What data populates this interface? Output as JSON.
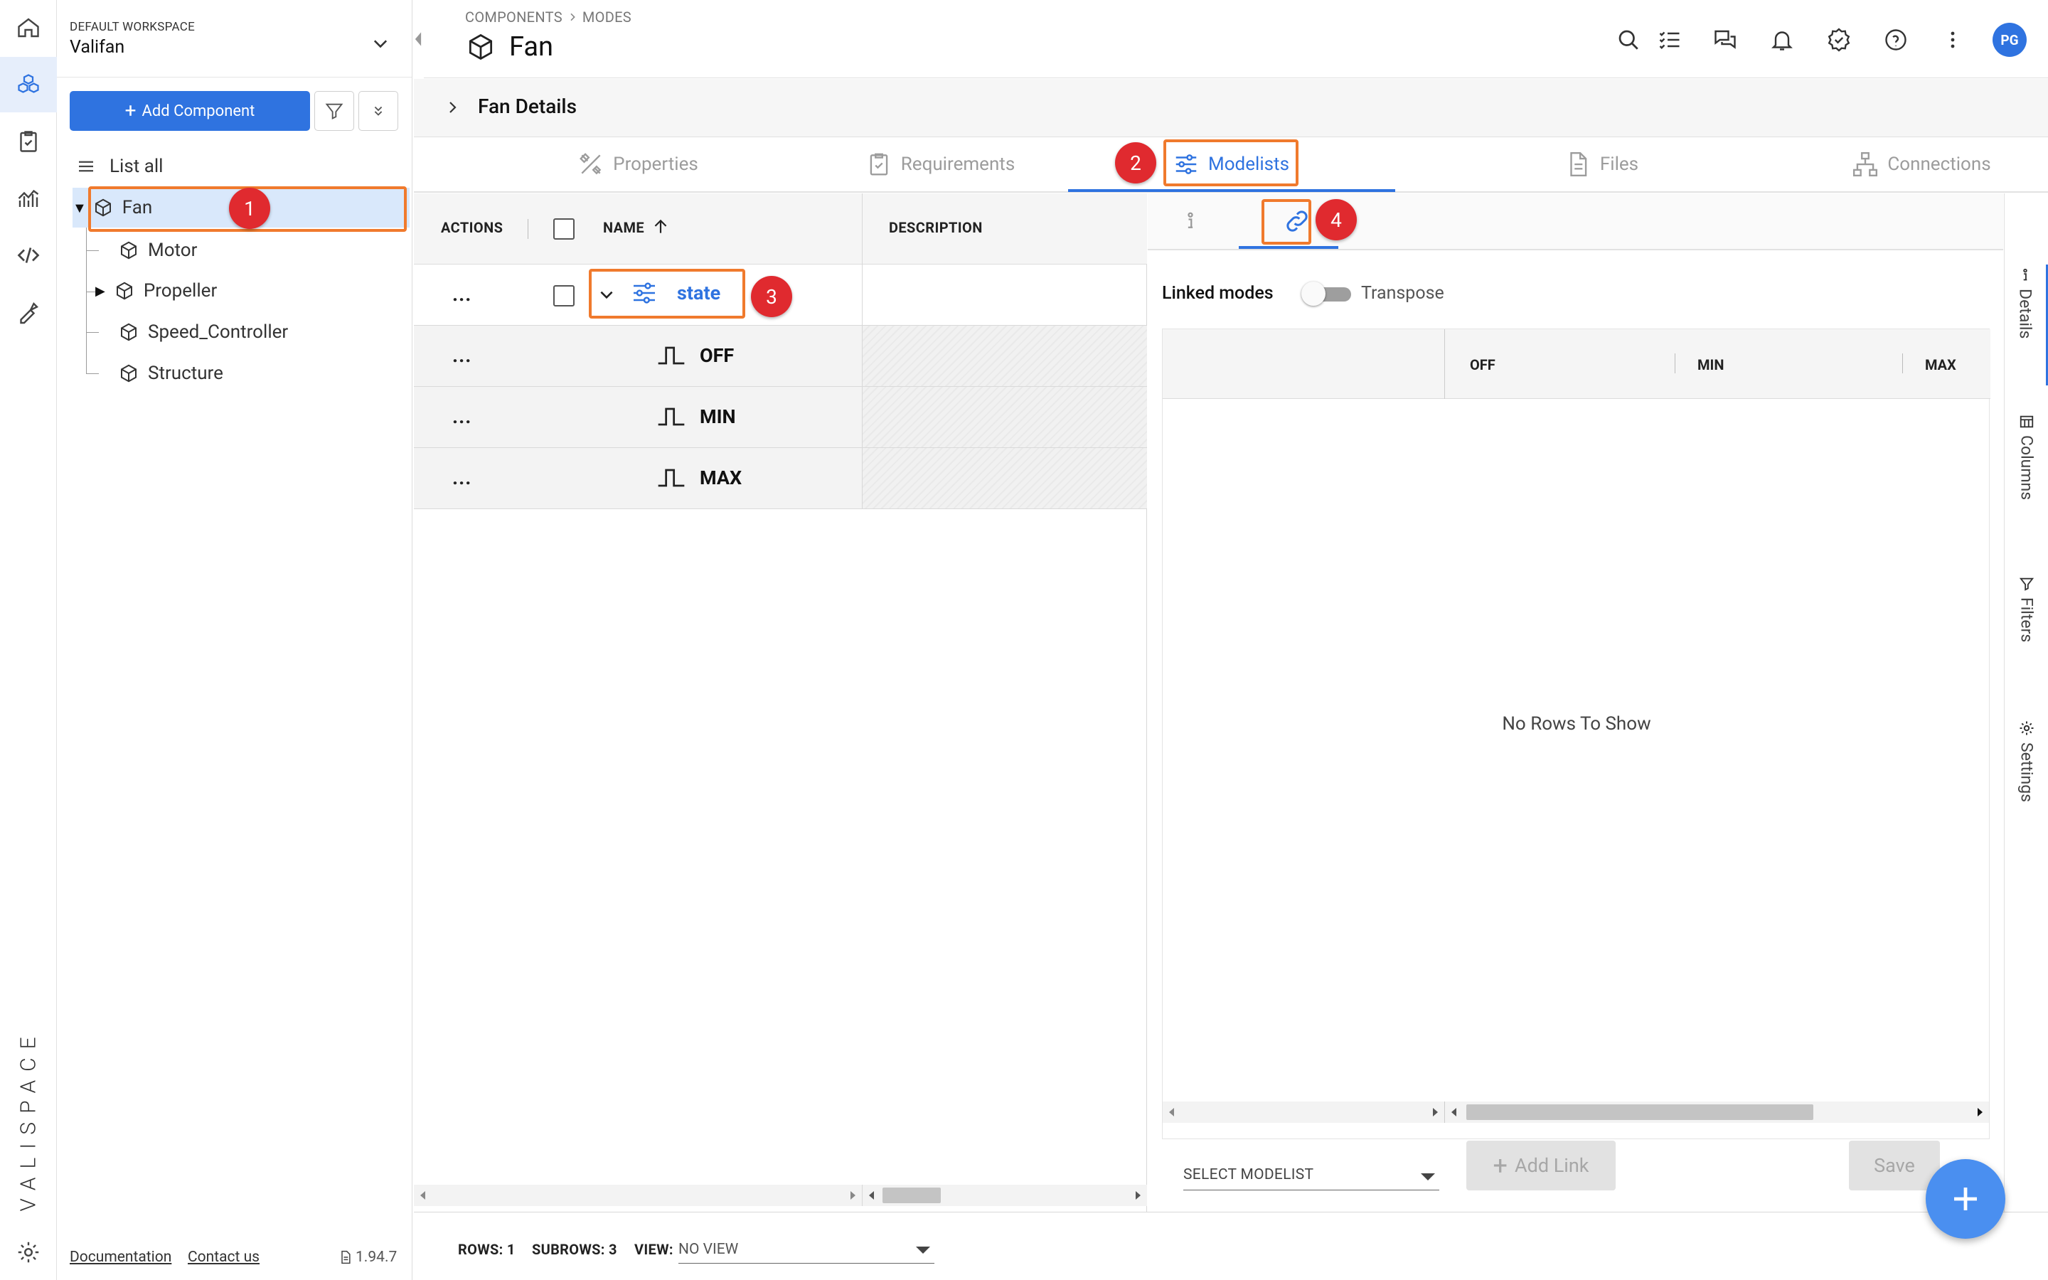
{
  "workspace": {
    "label": "DEFAULT WORKSPACE",
    "name": "Valifan"
  },
  "brand": "VALISPACE",
  "tree": {
    "add_label": "Add Component",
    "list_all": "List all",
    "items": [
      {
        "label": "Fan",
        "selected": true,
        "expanded": true
      },
      {
        "label": "Motor"
      },
      {
        "label": "Propeller",
        "expandable": true
      },
      {
        "label": "Speed_Controller"
      },
      {
        "label": "Structure"
      }
    ]
  },
  "footer_links": {
    "documentation": "Documentation",
    "contact": "Contact us",
    "version": "1.94.7"
  },
  "header": {
    "breadcrumb": [
      "COMPONENTS",
      "MODES"
    ],
    "title": "Fan",
    "avatar": "PG"
  },
  "details_bar": {
    "label": "Fan Details"
  },
  "tabs": [
    "Properties",
    "Requirements",
    "Modelists",
    "Files",
    "Connections"
  ],
  "active_tab": "Modelists",
  "grid": {
    "columns": [
      "ACTIONS",
      "NAME",
      "DESCRIPTION"
    ],
    "rows": [
      {
        "actions": "...",
        "name": "state",
        "type": "modelist"
      },
      {
        "actions": "...",
        "name": "OFF",
        "type": "mode"
      },
      {
        "actions": "...",
        "name": "MIN",
        "type": "mode"
      },
      {
        "actions": "...",
        "name": "MAX",
        "type": "mode"
      }
    ]
  },
  "linked_panel": {
    "linked_label": "Linked modes",
    "transpose_label": "Transpose",
    "columns": [
      "OFF",
      "MIN",
      "MAX"
    ],
    "empty": "No Rows To Show",
    "select_placeholder": "SELECT MODELIST",
    "add_link": "Add Link",
    "save": "Save"
  },
  "side_tabs": [
    "Details",
    "Columns",
    "Filters",
    "Settings"
  ],
  "status_bar": {
    "rows_label": "ROWS:",
    "rows": "1",
    "subrows_label": "SUBROWS:",
    "subrows": "3",
    "view_label": "VIEW:",
    "view": "NO VIEW"
  },
  "annotations": [
    "1",
    "2",
    "3",
    "4"
  ],
  "colors": {
    "accent": "#2f73e0",
    "highlight": "#f07a2d",
    "badge": "#e02a2f"
  }
}
